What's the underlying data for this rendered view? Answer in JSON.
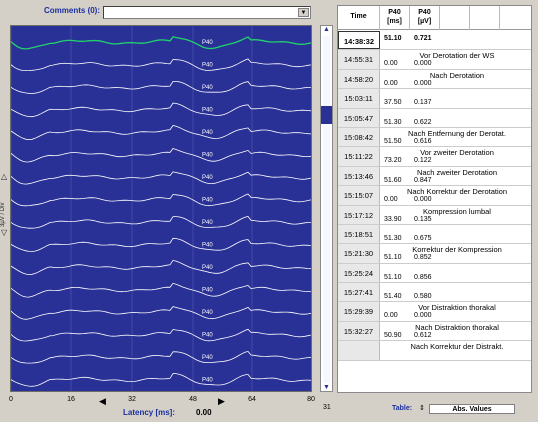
{
  "comments": {
    "label": "Comments (0):",
    "value": ""
  },
  "plot": {
    "y_label": "3µV / Div",
    "x_ticks": [
      "0",
      "16",
      "32",
      "48",
      "64",
      "80"
    ],
    "latency_label": "Latency [ms]:",
    "latency_value": "0.00",
    "peak_label": "P40",
    "colors": {
      "background": "#2a3196",
      "trace": "#ffffff",
      "top_trace": "#21d36b"
    }
  },
  "scroll_count": "31",
  "table": {
    "headers": {
      "time": "Time",
      "col1": "P40\n[ms]",
      "col2": "P40\n[µV]"
    },
    "rows": [
      {
        "time": "14:38:32",
        "v1": "51.10",
        "v2": "0.721",
        "comment": "",
        "selected": true
      },
      {
        "time": "14:55:31",
        "v1": "0.00",
        "v2": "0.000",
        "comment": "Vor Derotation der WS"
      },
      {
        "time": "14:58:20",
        "v1": "0.00",
        "v2": "0.000",
        "comment": "Nach Derotation"
      },
      {
        "time": "15:03:11",
        "v1": "37.50",
        "v2": "0.137",
        "comment": ""
      },
      {
        "time": "15:05:47",
        "v1": "51.30",
        "v2": "0.622",
        "comment": ""
      },
      {
        "time": "15:08:42",
        "v1": "51.50",
        "v2": "0.616",
        "comment": "Nach Entfernung der Derotat."
      },
      {
        "time": "15:11:22",
        "v1": "73.20",
        "v2": "0.122",
        "comment": "Vor zweiter Derotation"
      },
      {
        "time": "15:13:46",
        "v1": "51.60",
        "v2": "0.847",
        "comment": "Nach zweiter Derotation"
      },
      {
        "time": "15:15:07",
        "v1": "0.00",
        "v2": "0.000",
        "comment": "Nach Korrektur der Derotation"
      },
      {
        "time": "15:17:12",
        "v1": "33.90",
        "v2": "0.135",
        "comment": "Kompression lumbal"
      },
      {
        "time": "15:18:51",
        "v1": "51.30",
        "v2": "0.675",
        "comment": ""
      },
      {
        "time": "15:21:30",
        "v1": "51.10",
        "v2": "0.852",
        "comment": "Korrektur der Kompression"
      },
      {
        "time": "15:25:24",
        "v1": "51.10",
        "v2": "0.856",
        "comment": ""
      },
      {
        "time": "15:27:41",
        "v1": "51.40",
        "v2": "0.580",
        "comment": ""
      },
      {
        "time": "15:29:39",
        "v1": "0.00",
        "v2": "0.000",
        "comment": "Vor Distraktion thorakal"
      },
      {
        "time": "15:32:27",
        "v1": "50.90",
        "v2": "0.612",
        "comment": "Nach Distraktion thorakal"
      },
      {
        "time": "",
        "v1": "",
        "v2": "",
        "comment": "Nach Korrektur der Distrakt."
      }
    ],
    "footer_label": "Table:",
    "mode": "Abs. Values"
  }
}
